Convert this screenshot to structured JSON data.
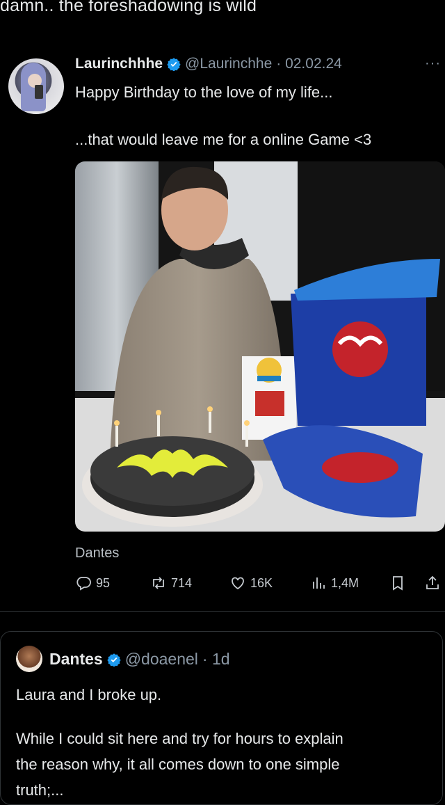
{
  "caption": "damn.. the foreshadowing is wild",
  "tweet": {
    "name": "Laurinchhhe",
    "handle": "@Laurinchhe",
    "date": "· 02.02.24",
    "more": "···",
    "line1": "Happy Birthday to the love of my life...",
    "line2": "...that would leave me for a online Game <3",
    "media_source": "Dantes",
    "stats": {
      "replies": "95",
      "retweets": "714",
      "likes": "16K",
      "views": "1,4M"
    }
  },
  "quote": {
    "name": "Dantes",
    "handle": "@doaenel",
    "time": "· 1d",
    "line1": "Laura and I broke up.",
    "para2_line1": "While I could sit here and try for hours to explain",
    "para2_line2": "the reason why, it all comes down to one simple",
    "para2_line3": "truth;..."
  },
  "colors": {
    "background": "#000000",
    "text": "#e7e9ea",
    "muted": "#8b98a5",
    "verified": "#1d9bf0"
  }
}
